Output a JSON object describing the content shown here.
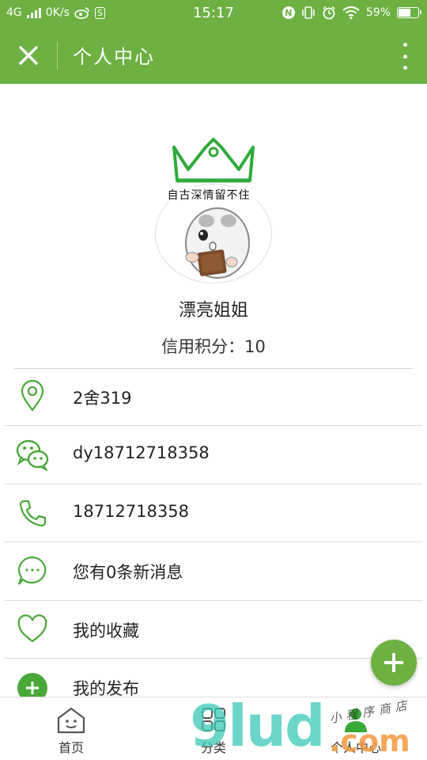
{
  "status_bar": {
    "network": "4G",
    "speed": "0K/s",
    "time": "15:17",
    "nfc": "N",
    "battery": "59%",
    "battery_level": 0.59
  },
  "header": {
    "title": "个人中心"
  },
  "profile": {
    "avatar_caption": "自古深情留不住",
    "nickname": "漂亮姐姐",
    "credit": "信用积分：10"
  },
  "list": [
    {
      "icon": "location-pin-icon",
      "label": "2舍319"
    },
    {
      "icon": "wechat-icon",
      "label": "dy18712718358"
    },
    {
      "icon": "phone-icon",
      "label": "18712718358"
    },
    {
      "icon": "message-bubble-icon",
      "label": "您有0条新消息"
    },
    {
      "icon": "heart-icon",
      "label": "我的收藏"
    },
    {
      "icon": "plus-circle-icon",
      "label": "我的发布"
    }
  ],
  "bottom_nav": [
    {
      "icon": "home-icon",
      "label": "首页"
    },
    {
      "icon": "category-icon",
      "label": "分类"
    },
    {
      "icon": "user-icon",
      "label": "个人中心"
    }
  ],
  "watermark": {
    "main": "9lud",
    "suffix": ".com",
    "tagline": "小程序商店"
  },
  "colors": {
    "brand": "#6cb142",
    "text": "#222222",
    "divider": "#dcdcdc"
  }
}
